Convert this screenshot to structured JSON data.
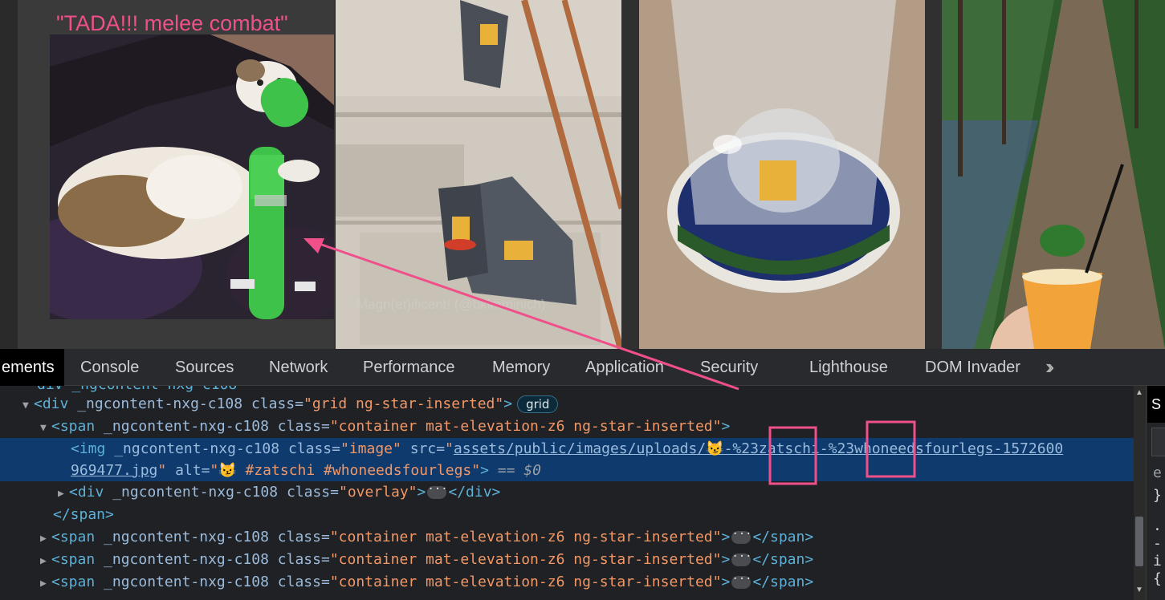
{
  "page": {
    "card_title": "\"TADA!!! melee combat\"",
    "watermark": "Magn(et)ificent! (@bkimminich)"
  },
  "devtools": {
    "tabs": [
      {
        "label": "ements",
        "active": true
      },
      {
        "label": "Console"
      },
      {
        "label": "Sources"
      },
      {
        "label": "Network"
      },
      {
        "label": "Performance"
      },
      {
        "label": "Memory"
      },
      {
        "label": "Application"
      },
      {
        "label": "Security"
      },
      {
        "label": "Lighthouse"
      },
      {
        "label": "DOM Invader"
      }
    ],
    "more_icon": "chevrons-right-icon",
    "dom": {
      "clipped_top": "div _ngcontent-nxg-c108",
      "grid_div": {
        "tag_open": "<div",
        "attr": "_ngcontent-nxg-c108",
        "class_name": "class",
        "class_value": "\"grid ng-star-inserted\"",
        "close": ">",
        "badge": "grid"
      },
      "span_open": {
        "tag_open": "<span",
        "attr": "_ngcontent-nxg-c108",
        "class_name": "class",
        "class_value": "\"container mat-elevation-z6 ng-star-inserted\"",
        "close": ">"
      },
      "img": {
        "tag_open": "<img",
        "attr": "_ngcontent-nxg-c108",
        "class_name": "class=",
        "class_value": "\"image\"",
        "src_name": "src=",
        "quote": "\"",
        "src_value_1": "assets/public/images/uploads/😼-%23zatschi-%23whoneedsfourlegs-1572600",
        "src_value_2": "969477.jpg",
        "alt_name": "alt=",
        "alt_value": "\"😼 #zatschi #whoneedsfourlegs\"",
        "close": ">",
        "console_ref": "== $0"
      },
      "overlay_div": {
        "tag_open": "<div",
        "attr": "_ngcontent-nxg-c108",
        "class_name": "class=",
        "class_value": "\"overlay\"",
        "close": ">",
        "end": "</div>"
      },
      "span_close": "</span>",
      "sibling_span": {
        "tag_open": "<span",
        "attr": "_ngcontent-nxg-c108",
        "class_name": "class=",
        "class_value": "\"container mat-elevation-z6 ng-star-inserted\"",
        "close": ">",
        "end": "</span>"
      }
    },
    "styles_panel": {
      "tab_fragment": "S",
      "lines": [
        "e",
        "}",
        ".",
        "-",
        "i",
        "{"
      ]
    }
  },
  "colors": {
    "annotation": "#f0508a",
    "selected_row": "#0e3a6e",
    "tag": "#5db0d7",
    "attr_value": "#f29766"
  }
}
